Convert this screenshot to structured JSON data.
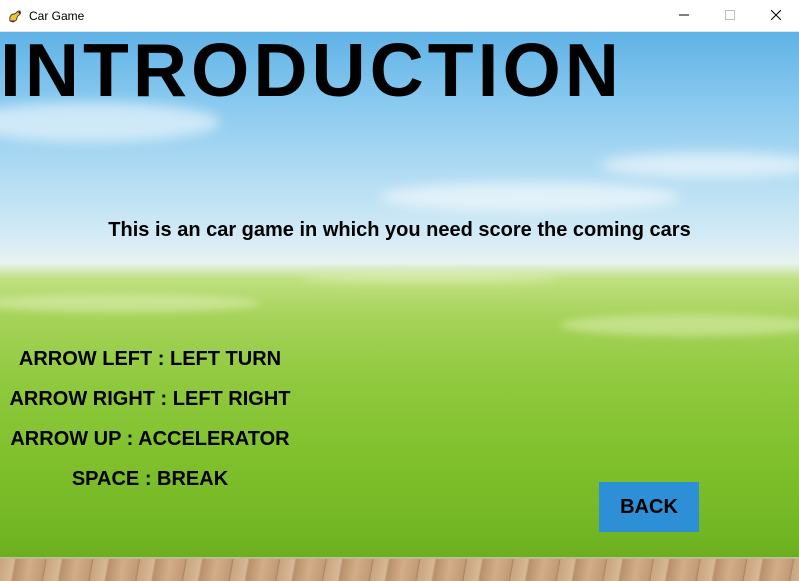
{
  "window": {
    "title": "Car Game",
    "app_icon": "pygame-snake-icon",
    "controls": {
      "minimize_icon": "minimize-icon",
      "maximize_icon": "maximize-icon",
      "close_icon": "close-icon"
    }
  },
  "game": {
    "heading": "INTRODUCTION",
    "description": "This is an car game in which you need score the coming cars",
    "controls": [
      "ARROW LEFT : LEFT TURN",
      "ARROW RIGHT : LEFT RIGHT",
      "ARROW UP : ACCELERATOR",
      "SPACE : BREAK"
    ],
    "back_label": "BACK"
  },
  "colors": {
    "back_button": "#2d8fd5",
    "text": "#000000",
    "sky": "#5fb2e6",
    "grass": "#7fc02c"
  }
}
